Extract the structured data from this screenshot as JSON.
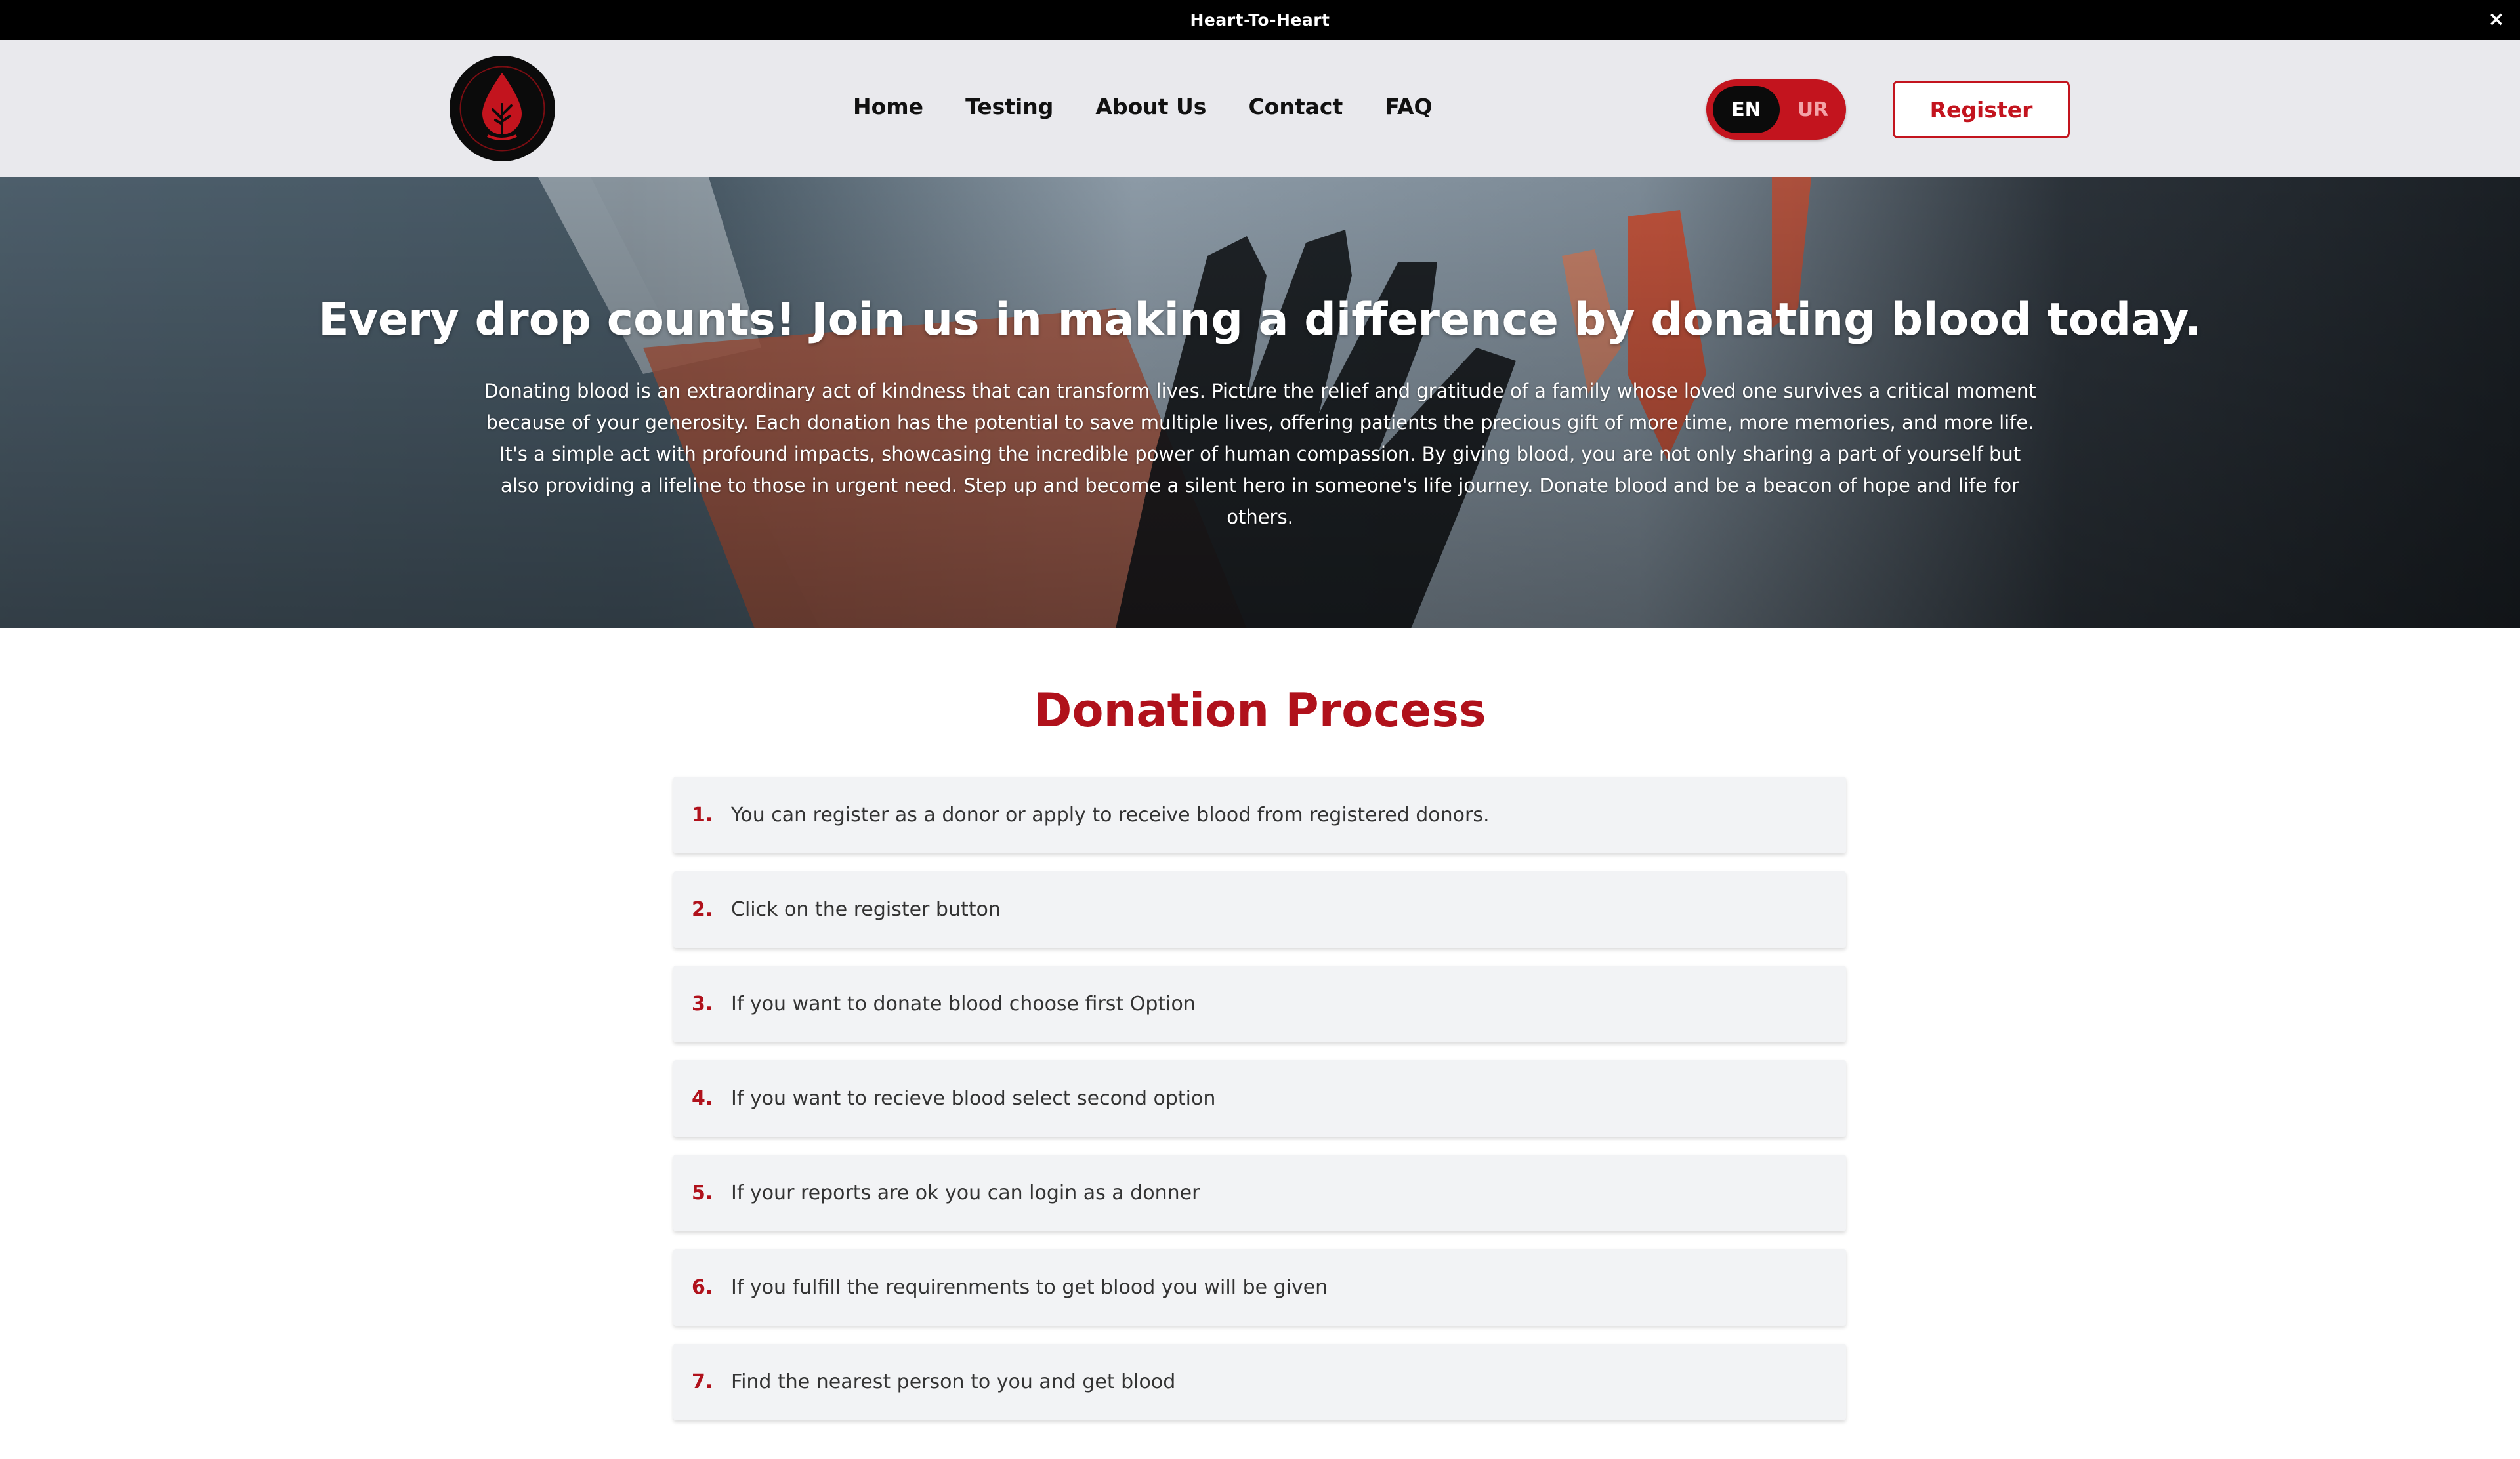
{
  "topbar": {
    "title": "Heart-To-Heart",
    "close_icon": "×"
  },
  "header": {
    "logo_icon": "blood-drop-tree-logo",
    "nav": [
      {
        "label": "Home"
      },
      {
        "label": "Testing"
      },
      {
        "label": "About Us"
      },
      {
        "label": "Contact"
      },
      {
        "label": "FAQ"
      }
    ],
    "lang": {
      "en": "EN",
      "ur": "UR",
      "selected": "EN"
    },
    "register_label": "Register"
  },
  "hero": {
    "title": "Every drop counts! Join us in making a difference by donating blood today.",
    "text": "Donating blood is an extraordinary act of kindness that can transform lives. Picture the relief and gratitude of a family whose loved one survives a critical moment because of your generosity. Each donation has the potential to save multiple lives, offering patients the precious gift of more time, more memories, and more life. It's a simple act with profound impacts, showcasing the incredible power of human compassion. By giving blood, you are not only sharing a part of yourself but also providing a lifeline to those in urgent need. Step up and become a silent hero in someone's life journey. Donate blood and be a beacon of hope and life for others."
  },
  "donation": {
    "title": "Donation Process",
    "steps": [
      {
        "num": "1.",
        "text": "You can register as a donor or apply to receive blood from registered donors."
      },
      {
        "num": "2.",
        "text": "Click on the register button"
      },
      {
        "num": "3.",
        "text": "If you want to donate blood choose first Option"
      },
      {
        "num": "4.",
        "text": "If you want to recieve blood select second option"
      },
      {
        "num": "5.",
        "text": "If your reports are ok you can login as a donner"
      },
      {
        "num": "6.",
        "text": "If you fulfill the requirenments to get blood you will be given"
      },
      {
        "num": "7.",
        "text": "Find the nearest person to you and get blood"
      }
    ]
  },
  "colors": {
    "brand_red": "#c3141e",
    "heading_red": "#b0111b",
    "topbar": "#000000",
    "header_bg": "#e9e9ed",
    "step_bg": "#f2f3f5"
  }
}
